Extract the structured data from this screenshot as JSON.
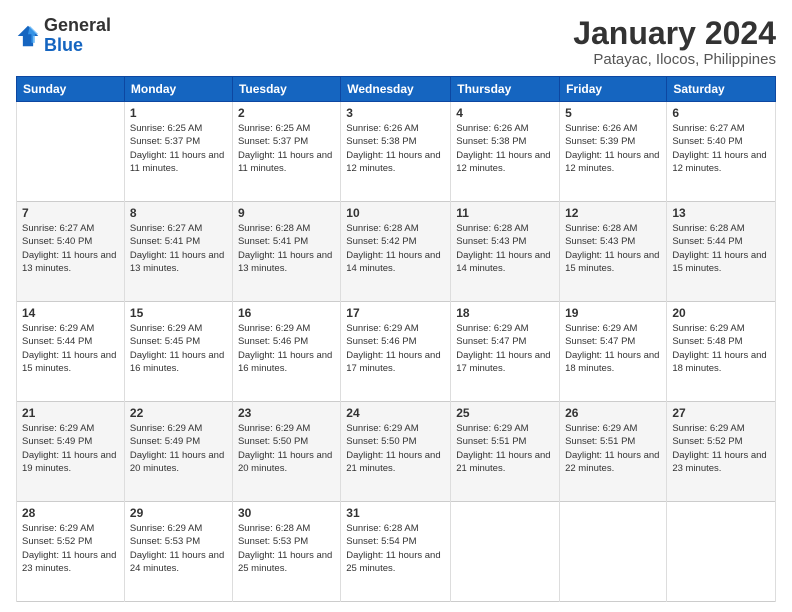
{
  "logo": {
    "general": "General",
    "blue": "Blue"
  },
  "header": {
    "month": "January 2024",
    "location": "Patayac, Ilocos, Philippines"
  },
  "days_of_week": [
    "Sunday",
    "Monday",
    "Tuesday",
    "Wednesday",
    "Thursday",
    "Friday",
    "Saturday"
  ],
  "weeks": [
    [
      {
        "day": "",
        "info": ""
      },
      {
        "day": "1",
        "info": "Sunrise: 6:25 AM\nSunset: 5:37 PM\nDaylight: 11 hours and 11 minutes."
      },
      {
        "day": "2",
        "info": "Sunrise: 6:25 AM\nSunset: 5:37 PM\nDaylight: 11 hours and 11 minutes."
      },
      {
        "day": "3",
        "info": "Sunrise: 6:26 AM\nSunset: 5:38 PM\nDaylight: 11 hours and 12 minutes."
      },
      {
        "day": "4",
        "info": "Sunrise: 6:26 AM\nSunset: 5:38 PM\nDaylight: 11 hours and 12 minutes."
      },
      {
        "day": "5",
        "info": "Sunrise: 6:26 AM\nSunset: 5:39 PM\nDaylight: 11 hours and 12 minutes."
      },
      {
        "day": "6",
        "info": "Sunrise: 6:27 AM\nSunset: 5:40 PM\nDaylight: 11 hours and 12 minutes."
      }
    ],
    [
      {
        "day": "7",
        "info": "Sunrise: 6:27 AM\nSunset: 5:40 PM\nDaylight: 11 hours and 13 minutes."
      },
      {
        "day": "8",
        "info": "Sunrise: 6:27 AM\nSunset: 5:41 PM\nDaylight: 11 hours and 13 minutes."
      },
      {
        "day": "9",
        "info": "Sunrise: 6:28 AM\nSunset: 5:41 PM\nDaylight: 11 hours and 13 minutes."
      },
      {
        "day": "10",
        "info": "Sunrise: 6:28 AM\nSunset: 5:42 PM\nDaylight: 11 hours and 14 minutes."
      },
      {
        "day": "11",
        "info": "Sunrise: 6:28 AM\nSunset: 5:43 PM\nDaylight: 11 hours and 14 minutes."
      },
      {
        "day": "12",
        "info": "Sunrise: 6:28 AM\nSunset: 5:43 PM\nDaylight: 11 hours and 15 minutes."
      },
      {
        "day": "13",
        "info": "Sunrise: 6:28 AM\nSunset: 5:44 PM\nDaylight: 11 hours and 15 minutes."
      }
    ],
    [
      {
        "day": "14",
        "info": "Sunrise: 6:29 AM\nSunset: 5:44 PM\nDaylight: 11 hours and 15 minutes."
      },
      {
        "day": "15",
        "info": "Sunrise: 6:29 AM\nSunset: 5:45 PM\nDaylight: 11 hours and 16 minutes."
      },
      {
        "day": "16",
        "info": "Sunrise: 6:29 AM\nSunset: 5:46 PM\nDaylight: 11 hours and 16 minutes."
      },
      {
        "day": "17",
        "info": "Sunrise: 6:29 AM\nSunset: 5:46 PM\nDaylight: 11 hours and 17 minutes."
      },
      {
        "day": "18",
        "info": "Sunrise: 6:29 AM\nSunset: 5:47 PM\nDaylight: 11 hours and 17 minutes."
      },
      {
        "day": "19",
        "info": "Sunrise: 6:29 AM\nSunset: 5:47 PM\nDaylight: 11 hours and 18 minutes."
      },
      {
        "day": "20",
        "info": "Sunrise: 6:29 AM\nSunset: 5:48 PM\nDaylight: 11 hours and 18 minutes."
      }
    ],
    [
      {
        "day": "21",
        "info": "Sunrise: 6:29 AM\nSunset: 5:49 PM\nDaylight: 11 hours and 19 minutes."
      },
      {
        "day": "22",
        "info": "Sunrise: 6:29 AM\nSunset: 5:49 PM\nDaylight: 11 hours and 20 minutes."
      },
      {
        "day": "23",
        "info": "Sunrise: 6:29 AM\nSunset: 5:50 PM\nDaylight: 11 hours and 20 minutes."
      },
      {
        "day": "24",
        "info": "Sunrise: 6:29 AM\nSunset: 5:50 PM\nDaylight: 11 hours and 21 minutes."
      },
      {
        "day": "25",
        "info": "Sunrise: 6:29 AM\nSunset: 5:51 PM\nDaylight: 11 hours and 21 minutes."
      },
      {
        "day": "26",
        "info": "Sunrise: 6:29 AM\nSunset: 5:51 PM\nDaylight: 11 hours and 22 minutes."
      },
      {
        "day": "27",
        "info": "Sunrise: 6:29 AM\nSunset: 5:52 PM\nDaylight: 11 hours and 23 minutes."
      }
    ],
    [
      {
        "day": "28",
        "info": "Sunrise: 6:29 AM\nSunset: 5:52 PM\nDaylight: 11 hours and 23 minutes."
      },
      {
        "day": "29",
        "info": "Sunrise: 6:29 AM\nSunset: 5:53 PM\nDaylight: 11 hours and 24 minutes."
      },
      {
        "day": "30",
        "info": "Sunrise: 6:28 AM\nSunset: 5:53 PM\nDaylight: 11 hours and 25 minutes."
      },
      {
        "day": "31",
        "info": "Sunrise: 6:28 AM\nSunset: 5:54 PM\nDaylight: 11 hours and 25 minutes."
      },
      {
        "day": "",
        "info": ""
      },
      {
        "day": "",
        "info": ""
      },
      {
        "day": "",
        "info": ""
      }
    ]
  ]
}
